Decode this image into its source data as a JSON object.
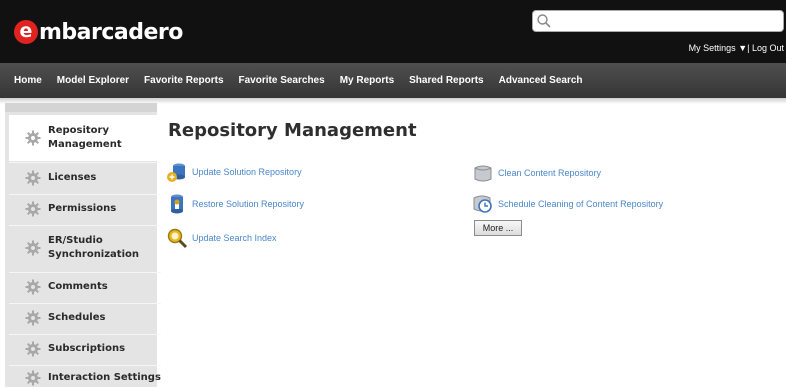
{
  "brand": {
    "logo_first": "e",
    "logo_rest": "mbarcadero"
  },
  "search": {
    "placeholder": ""
  },
  "user_menu": {
    "settings": "My Settings",
    "separator": "▼|",
    "logout": "Log Out"
  },
  "nav": {
    "home": "Home",
    "model_explorer": "Model Explorer",
    "favorite_reports": "Favorite Reports",
    "favorite_searches": "Favorite Searches",
    "my_reports": "My Reports",
    "shared_reports": "Shared Reports",
    "advanced_search": "Advanced Search"
  },
  "sidebar": {
    "items": [
      {
        "label": "Repository Management",
        "active": true,
        "icon": "gear-icon"
      },
      {
        "label": "Licenses",
        "icon": "gear-icon"
      },
      {
        "label": "Permissions",
        "icon": "gear-icon"
      },
      {
        "label": "ER/Studio Synchronization",
        "icon": "gear-icon"
      },
      {
        "label": "Comments",
        "icon": "gear-icon"
      },
      {
        "label": "Schedules",
        "icon": "gear-icon"
      },
      {
        "label": "Subscriptions",
        "icon": "gear-icon"
      },
      {
        "label": "Interaction Settings",
        "icon": "gear-icon"
      }
    ]
  },
  "main": {
    "title": "Repository Management",
    "actions": {
      "update_solution": "Update Solution Repository",
      "restore_solution": "Restore Solution Repository",
      "update_search_index": "Update Search Index",
      "clean_content": "Clean Content Repository",
      "schedule_cleaning": "Schedule Cleaning of Content Repository"
    },
    "more_button": "More ..."
  },
  "colors": {
    "header": "#111111",
    "nav": "#3f3f3f",
    "link": "#4a86c8",
    "logo_red": "#e0231f",
    "sidebar": "#e4e4e4"
  }
}
